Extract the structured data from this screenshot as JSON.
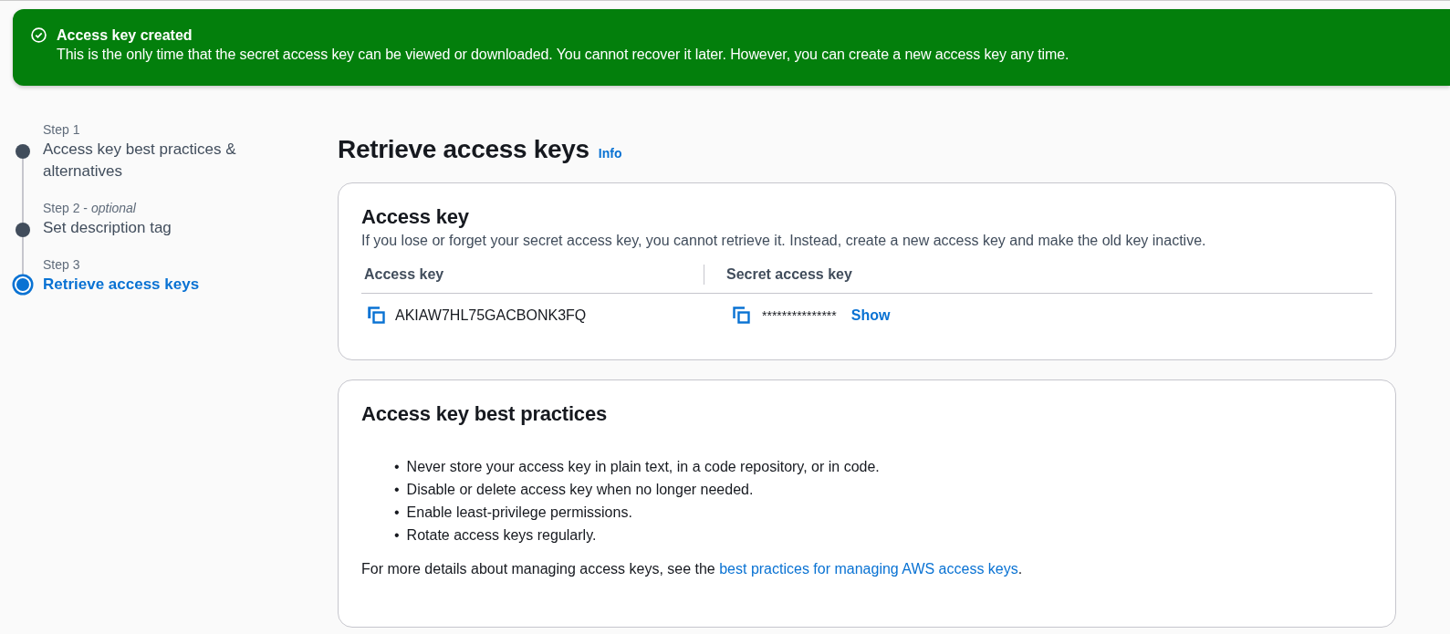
{
  "flash": {
    "kind": "success",
    "title": "Access key created",
    "message": "This is the only time that the secret access key can be viewed or downloaded. You cannot recover it later. However, you can create a new access key any time."
  },
  "steps": [
    {
      "label": "Step 1",
      "title": "Access key best practices & alternatives",
      "selected": false
    },
    {
      "label": "Step 2 - *optional*",
      "title": "Set description tag",
      "selected": false
    },
    {
      "label": "Step 3",
      "title": "Retrieve access keys",
      "selected": true
    }
  ],
  "page": {
    "title": "Retrieve access keys",
    "info": "Info"
  },
  "access_key_card": {
    "title": "Access key",
    "description": "If you lose or forget your secret access key, you cannot retrieve it. Instead, create a new access key and make the old key inactive.",
    "columns": [
      "Access key",
      "Secret access key"
    ],
    "access_key": "AKIAW7HL75GACBONK3FQ",
    "secret": "***************",
    "show": "Show"
  },
  "best_practices_card": {
    "title": "Access key best practices",
    "bullet": "•",
    "items": [
      "Never store your access key in plain text, in a code repository, or in code.",
      "Disable or delete access key when no longer needed.",
      "Enable least-privilege permissions.",
      "Rotate access keys regularly."
    ],
    "footer_text": "For more details about managing access keys, see the",
    "footer_link": "best practices for managing AWS access keys",
    "footer_end": "."
  }
}
